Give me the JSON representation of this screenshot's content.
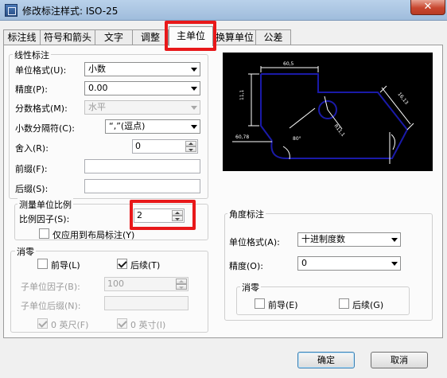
{
  "title": "修改标注样式: ISO-25",
  "close_glyph": "✕",
  "tabs": [
    "标注线",
    "符号和箭头",
    "文字",
    "调整",
    "主单位",
    "换算单位",
    "公差"
  ],
  "linear": {
    "group_label": "线性标注",
    "unit_format_label": "单位格式(U):",
    "unit_format_value": "小数",
    "precision_label": "精度(P):",
    "precision_value": "0.00",
    "fraction_format_label": "分数格式(M):",
    "fraction_format_value": "水平",
    "decimal_separator_label": "小数分隔符(C):",
    "decimal_separator_value": "“,”(逗点)",
    "round_off_label": "舍入(R):",
    "round_off_value": "0",
    "prefix_label": "前缀(F):",
    "prefix_value": "",
    "suffix_label": "后缀(S):",
    "suffix_value": ""
  },
  "measurement_scale": {
    "group_label": "测量单位比例",
    "scale_factor_label": "比例因子(S):",
    "scale_factor_value": "2",
    "apply_layout_label": "仅应用到布局标注(Y)",
    "apply_layout_checked": false
  },
  "zero_suppression": {
    "group_label": "消零",
    "leading_label": "前导(L)",
    "leading_checked": false,
    "trailing_label": "后续(T)",
    "trailing_checked": true,
    "sub_unit_factor_label": "子单位因子(B):",
    "sub_unit_factor_value": "100",
    "sub_unit_suffix_label": "子单位后缀(N):",
    "sub_unit_suffix_value": "",
    "feet_label": "0 英尺(F)",
    "feet_checked": true,
    "inches_label": "0 英寸(I)",
    "inches_checked": true
  },
  "angular": {
    "group_label": "角度标注",
    "unit_format_label": "单位格式(A):",
    "unit_format_value": "十进制度数",
    "precision_label": "精度(O):",
    "precision_value": "0",
    "zero_group_label": "消零",
    "leading_label": "前导(E)",
    "leading_checked": false,
    "trailing_label": "后续(G)",
    "trailing_checked": false
  },
  "preview": {
    "dim_top": "60,5",
    "dim_left": "11,1",
    "dim_right": "16,13",
    "dim_r": "R11,1",
    "dim_bottom": "60,78",
    "dim_angle": "80°"
  },
  "buttons": {
    "ok": "确定",
    "cancel": "取消"
  },
  "colors": {
    "preview_bg": "#000000",
    "preview_shape": "#1a1aa8",
    "highlight": "#e8181a"
  }
}
